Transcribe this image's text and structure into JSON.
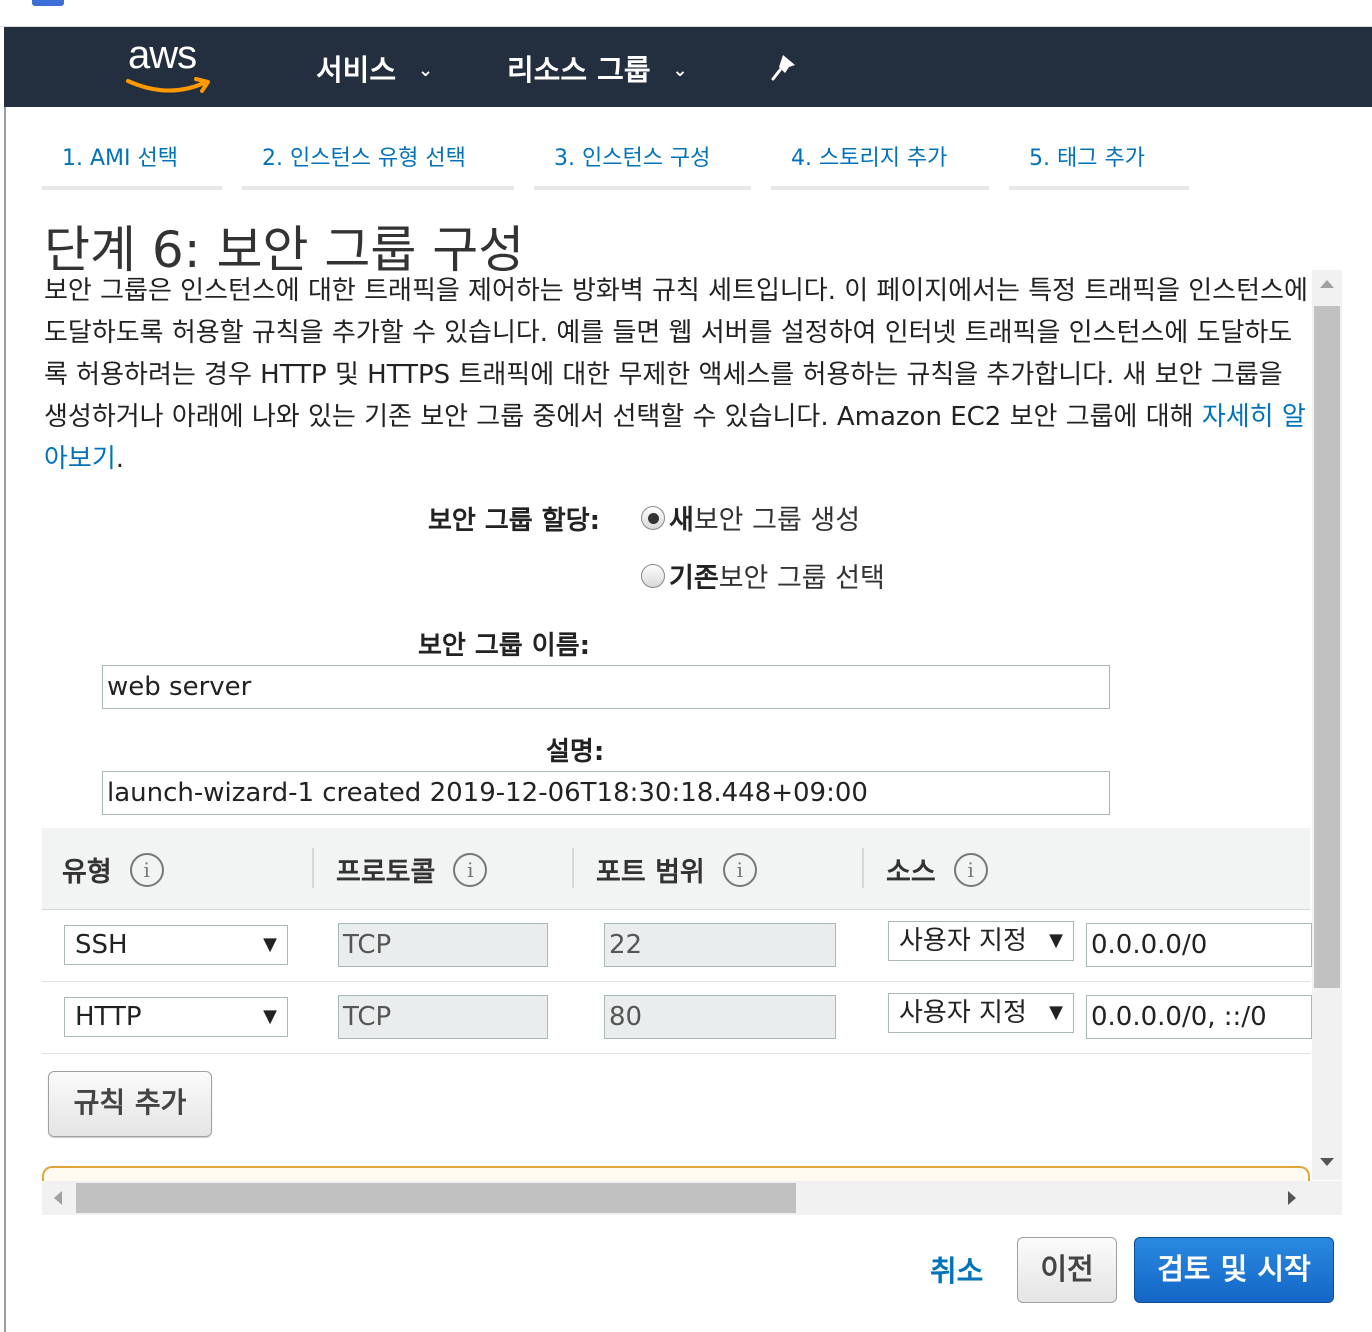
{
  "nav": {
    "logo_text": "aws",
    "services": "서비스",
    "resource_groups": "리소스 그룹"
  },
  "colors": {
    "navbar": "#232f3e",
    "accent_orange": "#ff9900",
    "link_blue": "#0073bb",
    "primary_button": "#1466c6"
  },
  "steps": [
    {
      "label": "1. AMI 선택"
    },
    {
      "label": "2. 인스턴스 유형 선택"
    },
    {
      "label": "3. 인스턴스 구성"
    },
    {
      "label": "4. 스토리지 추가"
    },
    {
      "label": "5. 태그 추가"
    }
  ],
  "page": {
    "title": "단계 6: 보안 그룹 구성",
    "description": "보안 그룹은 인스턴스에 대한 트래픽을 제어하는 방화벽 규칙 세트입니다. 이 페이지에서는 특정 트래픽을 인스턴스에 도달하도록 허용할 규칙을 추가할 수 있습니다. 예를 들면 웹 서버를 설정하여 인터넷 트래픽을 인스턴스에 도달하도록 허용하려는 경우 HTTP 및 HTTPS 트래픽에 대한 무제한 액세스를 허용하는 규칙을 추가합니다. 새 보안 그룹을 생성하거나 아래에 나와 있는 기존 보안 그룹 중에서 선택할 수 있습니다. Amazon EC2 보안 그룹에 대해 ",
    "learn_more": "자세히 알아보기",
    "period": "."
  },
  "assign": {
    "label": "보안 그룹 할당:",
    "option_new_bold": "새",
    "option_new_rest": " 보안 그룹 생성",
    "option_existing_bold": "기존",
    "option_existing_rest": " 보안 그룹 선택"
  },
  "form": {
    "name_label": "보안 그룹 이름:",
    "name_value": "web server",
    "desc_label": "설명:",
    "desc_value": "launch-wizard-1 created 2019-12-06T18:30:18.448+09:00"
  },
  "table": {
    "headers": [
      "유형",
      "프로토콜",
      "포트 범위",
      "소스"
    ],
    "info_glyph": "i",
    "rows": [
      {
        "type": "SSH",
        "protocol": "TCP",
        "port": "22",
        "source_mode": "사용자 지정",
        "source_value": "0.0.0.0/0"
      },
      {
        "type": "HTTP",
        "protocol": "TCP",
        "port": "80",
        "source_mode": "사용자 지정",
        "source_value": "0.0.0.0/0, ::/0"
      }
    ]
  },
  "actions": {
    "add_rule": "규칙 추가",
    "cancel": "취소",
    "previous": "이전",
    "review_launch": "검토 및 시작"
  }
}
